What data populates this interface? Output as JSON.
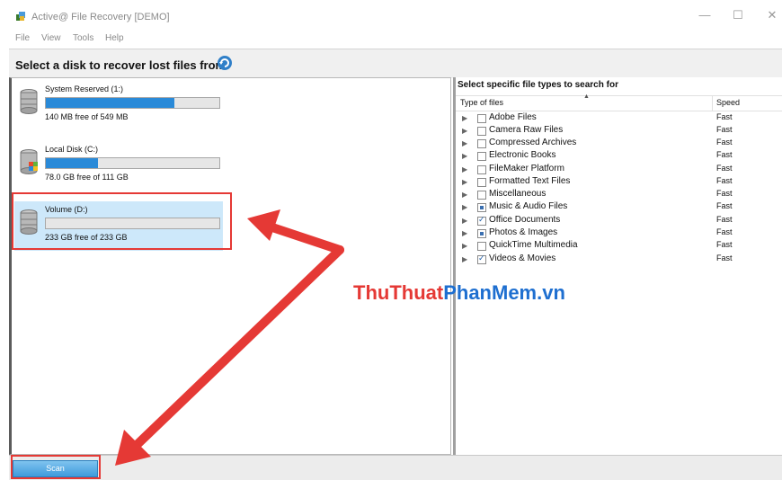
{
  "window": {
    "title": "Active@ File Recovery [DEMO]",
    "controls": {
      "minimize": "—",
      "maximize": "☐",
      "close": "✕"
    }
  },
  "menu": [
    "File",
    "View",
    "Tools",
    "Help"
  ],
  "header": {
    "title": "Select a disk to recover lost files from"
  },
  "disks": [
    {
      "name": "System Reserved (1:)",
      "free": "140 MB free of 549 MB",
      "used_fraction": 0.74,
      "selected": false
    },
    {
      "name": "Local Disk (C:)",
      "free": "78.0 GB free of 111 GB",
      "used_fraction": 0.3,
      "selected": false
    },
    {
      "name": "Volume (D:)",
      "free": "233 GB free of 233 GB",
      "used_fraction": 0.0,
      "selected": true
    }
  ],
  "file_types": {
    "title": "Select specific file types to search for",
    "columns": {
      "type": "Type of files",
      "speed": "Speed"
    },
    "rows": [
      {
        "label": "Adobe Files",
        "speed": "Fast",
        "state": "unchecked"
      },
      {
        "label": "Camera Raw Files",
        "speed": "Fast",
        "state": "unchecked"
      },
      {
        "label": "Compressed Archives",
        "speed": "Fast",
        "state": "unchecked"
      },
      {
        "label": "Electronic Books",
        "speed": "Fast",
        "state": "unchecked"
      },
      {
        "label": "FileMaker Platform",
        "speed": "Fast",
        "state": "unchecked"
      },
      {
        "label": "Formatted Text Files",
        "speed": "Fast",
        "state": "unchecked"
      },
      {
        "label": "Miscellaneous",
        "speed": "Fast",
        "state": "unchecked"
      },
      {
        "label": "Music & Audio Files",
        "speed": "Fast",
        "state": "partial"
      },
      {
        "label": "Office Documents",
        "speed": "Fast",
        "state": "checked"
      },
      {
        "label": "Photos & Images",
        "speed": "Fast",
        "state": "partial"
      },
      {
        "label": "QuickTime Multimedia",
        "speed": "Fast",
        "state": "unchecked"
      },
      {
        "label": "Videos & Movies",
        "speed": "Fast",
        "state": "checked"
      }
    ]
  },
  "scan_button": {
    "label": "Scan"
  },
  "watermark": {
    "part1": "ThuThuat",
    "part2": "PhanMem.vn"
  },
  "colors": {
    "accent": "#2a8ad8",
    "highlight": "#e53935",
    "selected_bg": "#cde8fa"
  }
}
